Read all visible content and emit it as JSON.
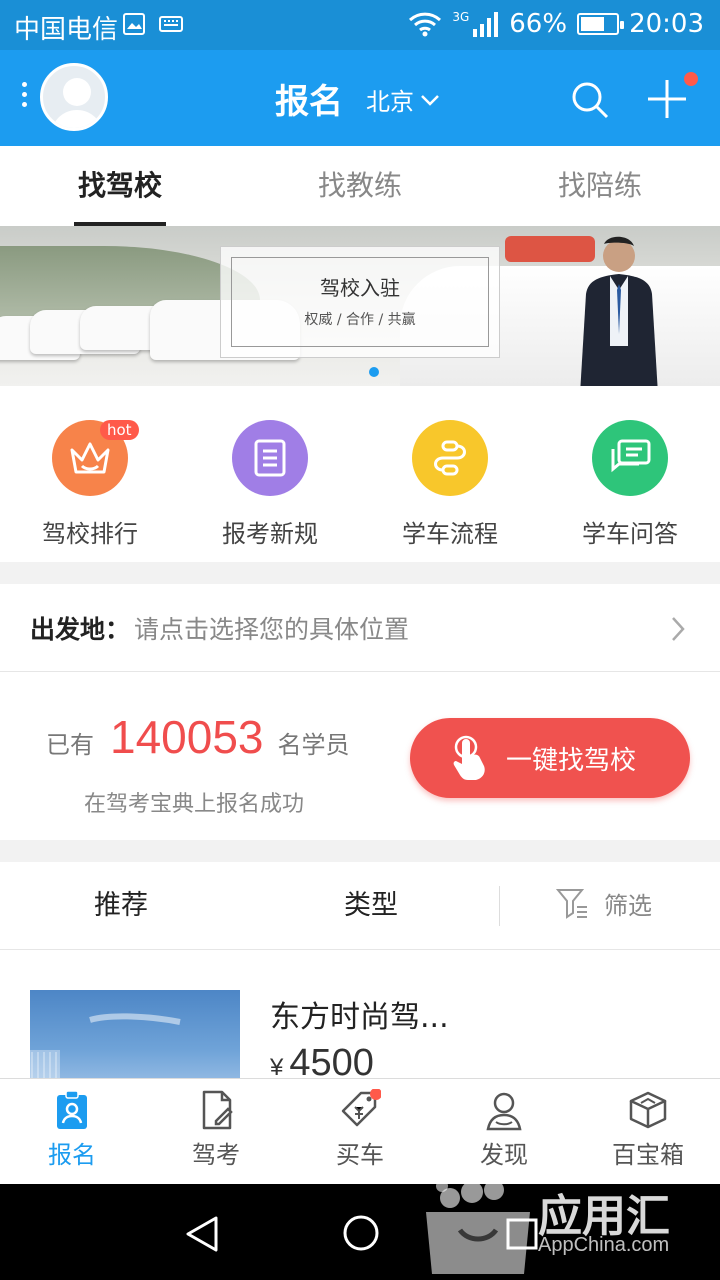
{
  "status_bar": {
    "carrier": "中国电信",
    "network": "3G",
    "battery": "66%",
    "battery_level": 0.66,
    "time": "20:03"
  },
  "header": {
    "title": "报名",
    "city": "北京",
    "has_notification": true
  },
  "tabs": [
    {
      "label": "找驾校",
      "active": true
    },
    {
      "label": "找教练",
      "active": false
    },
    {
      "label": "找陪练",
      "active": false
    }
  ],
  "banner": {
    "heading": "驾校入驻",
    "subheading": "权威 / 合作 / 共赢"
  },
  "quick_links": [
    {
      "label": "驾校排行",
      "icon": "crown-icon",
      "color": "#f7834a",
      "badge": "hot"
    },
    {
      "label": "报考新规",
      "icon": "document-icon",
      "color": "#a07ee6",
      "badge": ""
    },
    {
      "label": "学车流程",
      "icon": "flow-icon",
      "color": "#f8c72b",
      "badge": ""
    },
    {
      "label": "学车问答",
      "icon": "chat-icon",
      "color": "#2ec57a",
      "badge": ""
    }
  ],
  "origin": {
    "label": "出发地：",
    "placeholder": "请点击选择您的具体位置"
  },
  "stats": {
    "prefix": "已有",
    "count": "140053",
    "suffix": "名学员",
    "subtitle": "在驾考宝典上报名成功",
    "cta_label": "一键找驾校"
  },
  "filters": {
    "recommend": "推荐",
    "type": "类型",
    "screen": "筛选"
  },
  "listing": {
    "name": "东方时尚驾...",
    "currency": "¥",
    "price": "4500"
  },
  "bottom_nav": [
    {
      "label": "报名",
      "icon": "signup-icon",
      "active": true
    },
    {
      "label": "驾考",
      "icon": "exam-icon",
      "active": false
    },
    {
      "label": "买车",
      "icon": "price-tag-icon",
      "active": false
    },
    {
      "label": "发现",
      "icon": "person-icon",
      "active": false
    },
    {
      "label": "百宝箱",
      "icon": "box-icon",
      "active": false
    }
  ],
  "watermark": {
    "text": "应用汇",
    "sub": "AppChina.com"
  },
  "colors": {
    "primary": "#1c9cf0",
    "accent": "#f0524f"
  }
}
